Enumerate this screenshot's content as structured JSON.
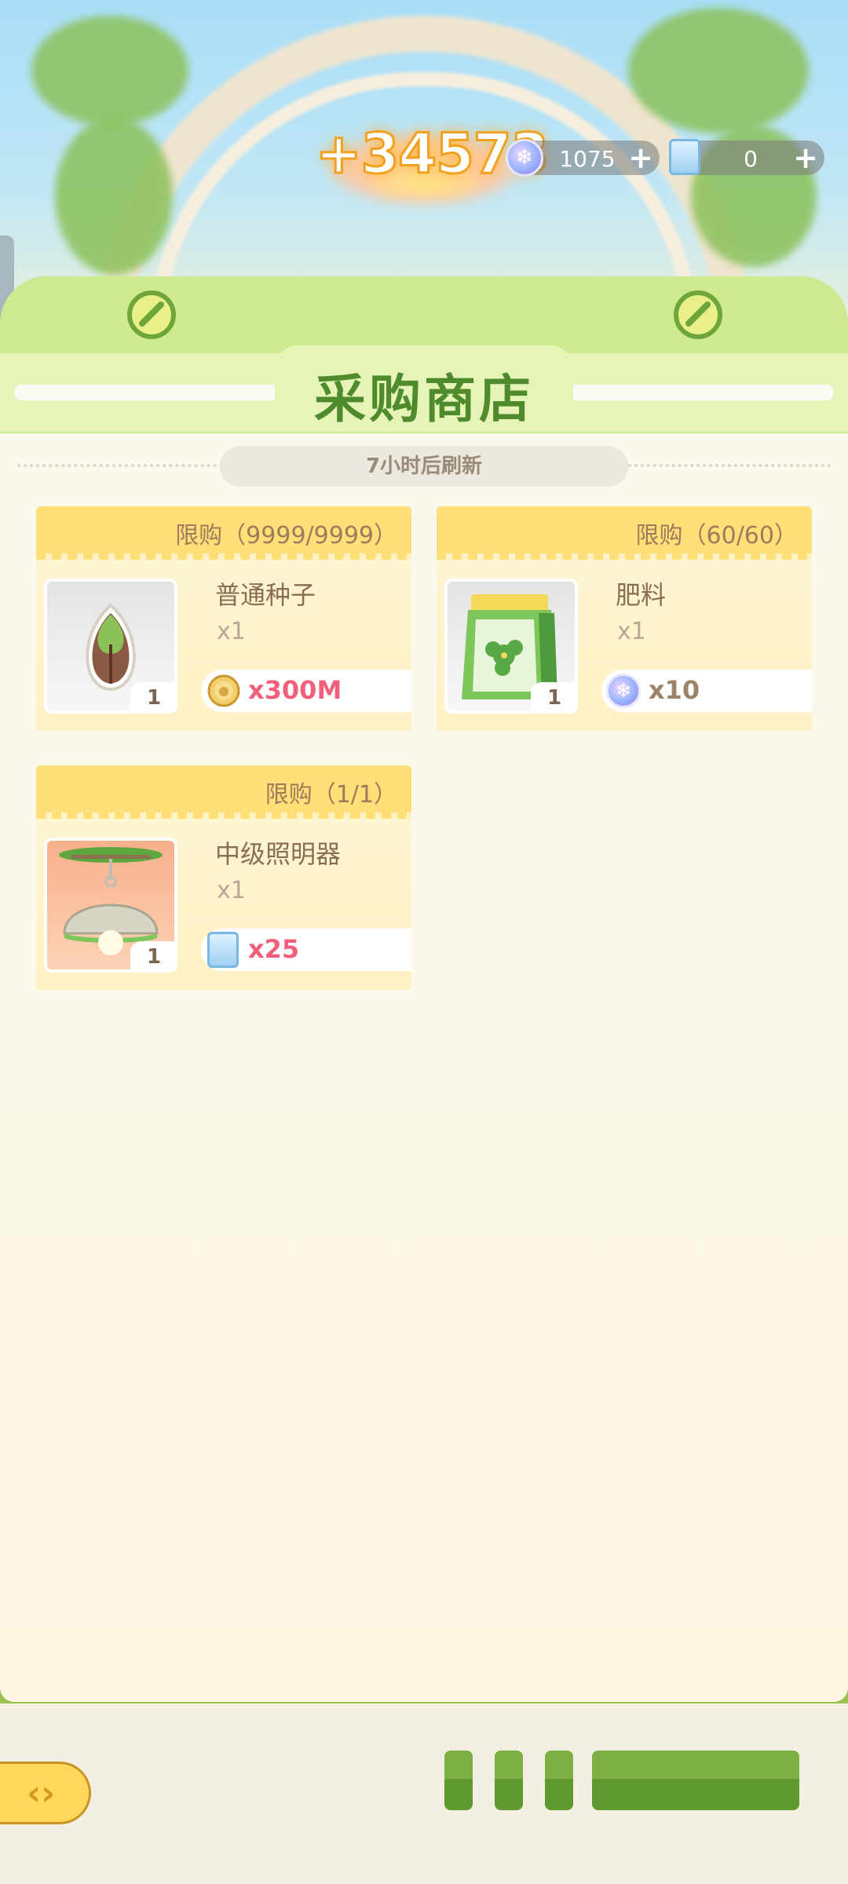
{
  "header": {
    "score": "+34573",
    "currencies": [
      {
        "icon": "snowflake-gem-icon",
        "value": "1075"
      },
      {
        "icon": "ticket-bag-icon",
        "value": "0"
      }
    ]
  },
  "shop": {
    "title": "采购商店",
    "refresh_text": "7小时后刷新",
    "items": [
      {
        "limit": "限购（9999/9999）",
        "name": "普通种子",
        "count": "x1",
        "quantity": "1",
        "price": "x300M",
        "price_color": "#f0607a",
        "price_icon": "gold-coin-icon",
        "image": "seed-icon"
      },
      {
        "limit": "限购（60/60）",
        "name": "肥料",
        "count": "x1",
        "quantity": "1",
        "price": "x10",
        "price_color": "#9c8468",
        "price_icon": "snowflake-gem-icon",
        "image": "fertilizer-bag-icon"
      },
      {
        "limit": "限购（1/1）",
        "name": "中级照明器",
        "count": "x1",
        "quantity": "1",
        "price": "x25",
        "price_color": "#f0607a",
        "price_icon": "ticket-bag-icon",
        "image": "lamp-icon"
      }
    ]
  },
  "colors": {
    "panel_green": "#98c24b",
    "title_green": "#4f8a2c",
    "card_yellow": "#ffdf78",
    "price_pink": "#f0607a"
  }
}
